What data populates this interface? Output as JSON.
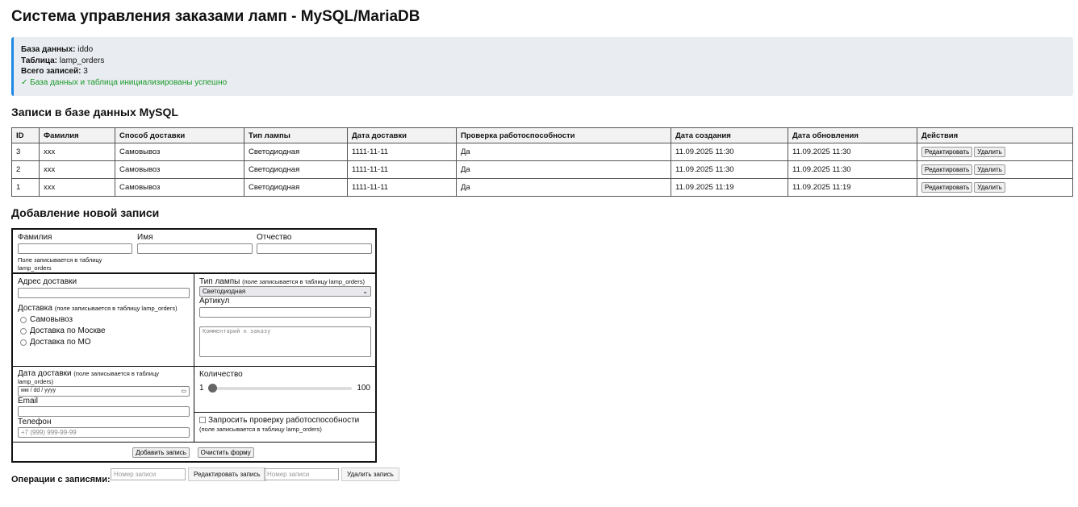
{
  "title": "Система управления заказами ламп - MySQL/MariaDB",
  "info": {
    "db_label": "База данных:",
    "db": "iddo",
    "table_label": "Таблица:",
    "table": "lamp_orders",
    "count_label": "Всего записей:",
    "count": "3",
    "status": "✓ База данных и таблица инициализированы успешно"
  },
  "records_heading": "Записи в базе данных MySQL",
  "columns": [
    "ID",
    "Фамилия",
    "Способ доставки",
    "Тип лампы",
    "Дата доставки",
    "Проверка работоспособности",
    "Дата создания",
    "Дата обновления",
    "Действия"
  ],
  "rows": [
    [
      "3",
      "xxx",
      "Самовывоз",
      "Светодиодная",
      "1111-11-11",
      "Да",
      "11.09.2025 11:30",
      "11.09.2025 11:30"
    ],
    [
      "2",
      "xxx",
      "Самовывоз",
      "Светодиодная",
      "1111-11-11",
      "Да",
      "11.09.2025 11:30",
      "11.09.2025 11:30"
    ],
    [
      "1",
      "xxx",
      "Самовывоз",
      "Светодиодная",
      "1111-11-11",
      "Да",
      "11.09.2025 11:19",
      "11.09.2025 11:19"
    ]
  ],
  "row_actions": {
    "edit": "Редактировать",
    "delete": "Удалить"
  },
  "add_heading": "Добавление новой записи",
  "form": {
    "surname": "Фамилия",
    "name": "Имя",
    "patronymic": "Отчество",
    "surname_note": "Поле записывается в таблицу lamp_orders",
    "address": "Адрес доставки",
    "delivery": "Доставка",
    "delivery_note": "(поле записывается в таблицу lamp_orders)",
    "delivery_options": [
      "Самовывоз",
      "Доставка по Москве",
      "Доставка по МО"
    ],
    "lamp_type": "Тип лампы",
    "lamp_note": "(поле записывается в таблицу lamp_orders)",
    "lamp_selected": "Светодиодная",
    "article": "Артикул",
    "comment_placeholder": "Комментарий к заказу",
    "date": "Дата доставки",
    "date_note": "(поле записывается в таблицу lamp_orders)",
    "date_placeholder": "мм / dd / yyyy",
    "email": "Email",
    "phone": "Телефон",
    "phone_placeholder": "+7 (999) 999-99-99",
    "quantity": "Количество",
    "qty_min": "1",
    "qty_max": "100",
    "check": "Запросить проверку работоспособности",
    "check_note": "(поле записывается в таблицу lamp_orders)",
    "add": "Добавить запись",
    "clear": "Очистить форму"
  },
  "ops": {
    "label": "Операции с записями:",
    "placeholder": "Номер записи",
    "edit": "Редактировать запись",
    "delete": "Удалить запись"
  }
}
